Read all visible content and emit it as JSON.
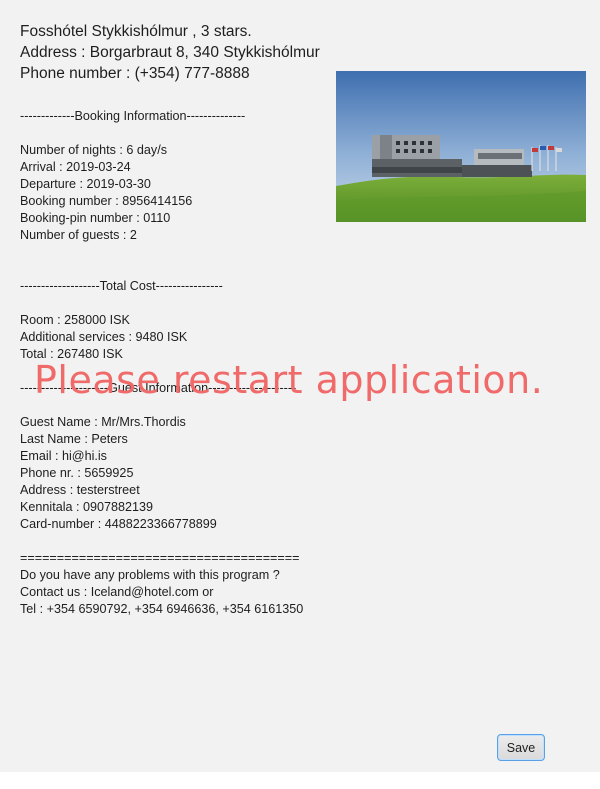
{
  "header": {
    "hotel": "Fosshótel Stykkishólmur , 3 stars.",
    "address": "Address : Borgarbraut 8, 340 Stykkishólmur",
    "phone": "Phone number : (+354) 777-8888"
  },
  "booking": {
    "heading": "-------------Booking Information--------------",
    "nights": "Number of nights : 6 day/s",
    "arrival": "Arrival : 2019-03-24",
    "departure": "Departure : 2019-03-30",
    "booking_number": "Booking number : 8956414156",
    "booking_pin": "Booking-pin number : 0110",
    "guests": "Number of guests : 2"
  },
  "cost": {
    "heading": "-------------------Total Cost----------------",
    "room": "Room : 258000 ISK",
    "additional": "Additional services : 9480 ISK",
    "total": "Total : 267480 ISK"
  },
  "guest": {
    "heading": "---------------------Guest Information---------------------",
    "guest_name": "Guest Name : Mr/Mrs.Thordis",
    "last_name": "Last Name : Peters",
    "email": "Email : hi@hi.is",
    "phone": "Phone nr. : 5659925",
    "address": "Address : testerstreet",
    "kennitala": "Kennitala : 0907882139",
    "card": "Card-number : 4488223366778899"
  },
  "contact": {
    "divider": "======================================",
    "question": "Do you have any problems with this program ?",
    "email": "Contact us : Iceland@hotel.com or",
    "tel": "Tel : +354 6590792, +354 6946636, +354 6161350"
  },
  "overlay": {
    "message": "Please restart application."
  },
  "actions": {
    "save_label": "Save"
  }
}
